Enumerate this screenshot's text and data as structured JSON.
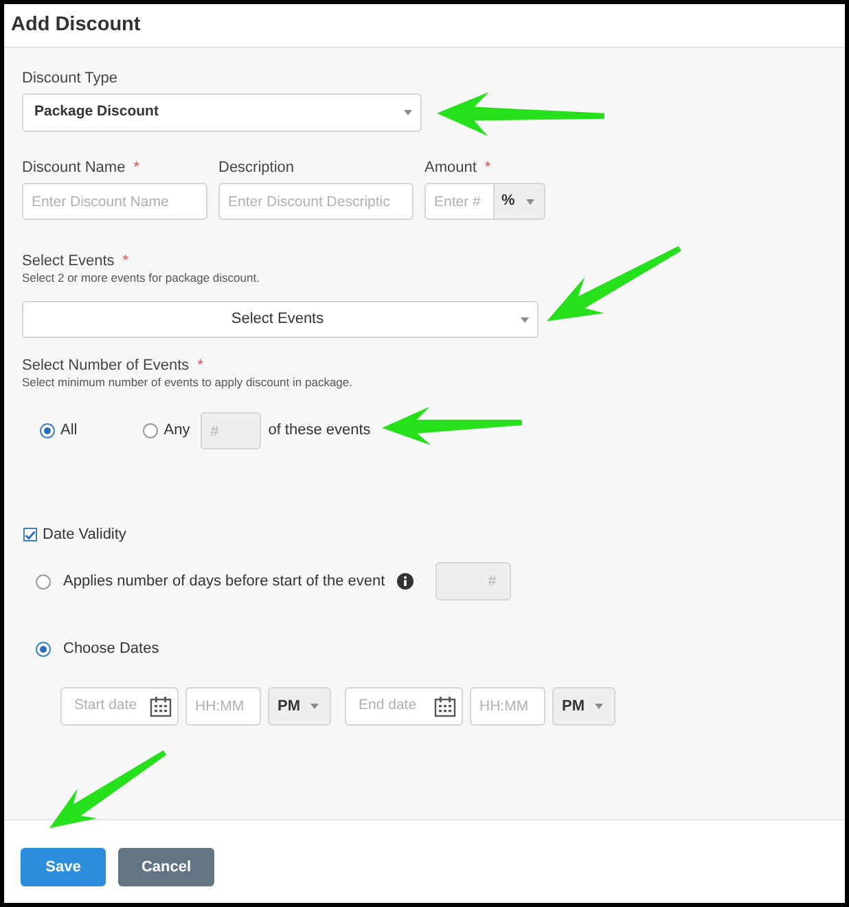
{
  "title": "Add Discount",
  "discount_type": {
    "label": "Discount Type",
    "value": "Package Discount"
  },
  "details": [
    {
      "label": "Discount Name",
      "required_mark": "*",
      "placeholder": "Enter Discount Name"
    },
    {
      "label": "Description",
      "placeholder": "Enter Discount Descriptic"
    },
    {
      "label": "Amount",
      "required_mark": "*",
      "placeholder": "Enter #",
      "unit": "%"
    }
  ],
  "select_events": {
    "label": "Select Events",
    "required_mark": "*",
    "hint": "Select 2 or more events for package discount.",
    "text": "Select Events"
  },
  "event_count": {
    "label": "Select Number of Events",
    "required_mark": "*",
    "hint": "Select minimum number of events to apply discount in package.",
    "options": [
      {
        "label": "All",
        "selected": true
      },
      {
        "label": "Any",
        "selected": false
      }
    ],
    "count": {
      "placeholder": "#",
      "disabled": true
    },
    "suffix": "of these events"
  },
  "date_validity": {
    "label": "Date Validity",
    "checked": true,
    "options": [
      {
        "kind": "days",
        "label": "Applies number of days before start of the event",
        "selected": false,
        "field": {
          "placeholder": "#",
          "disabled": true
        }
      },
      {
        "kind": "dates",
        "label": "Choose Dates",
        "selected": true
      }
    ],
    "range": [
      {
        "kind": "date",
        "placeholder": "Start date"
      },
      {
        "kind": "time",
        "placeholder": "HH:MM"
      },
      {
        "kind": "period",
        "value": "PM"
      },
      {
        "kind": "date",
        "placeholder": "End date"
      },
      {
        "kind": "time",
        "placeholder": "HH:MM"
      },
      {
        "kind": "period",
        "value": "PM"
      }
    ]
  },
  "buttons": [
    {
      "label": "Save",
      "kind": "primary"
    },
    {
      "label": "Cancel",
      "kind": "secondary"
    }
  ]
}
